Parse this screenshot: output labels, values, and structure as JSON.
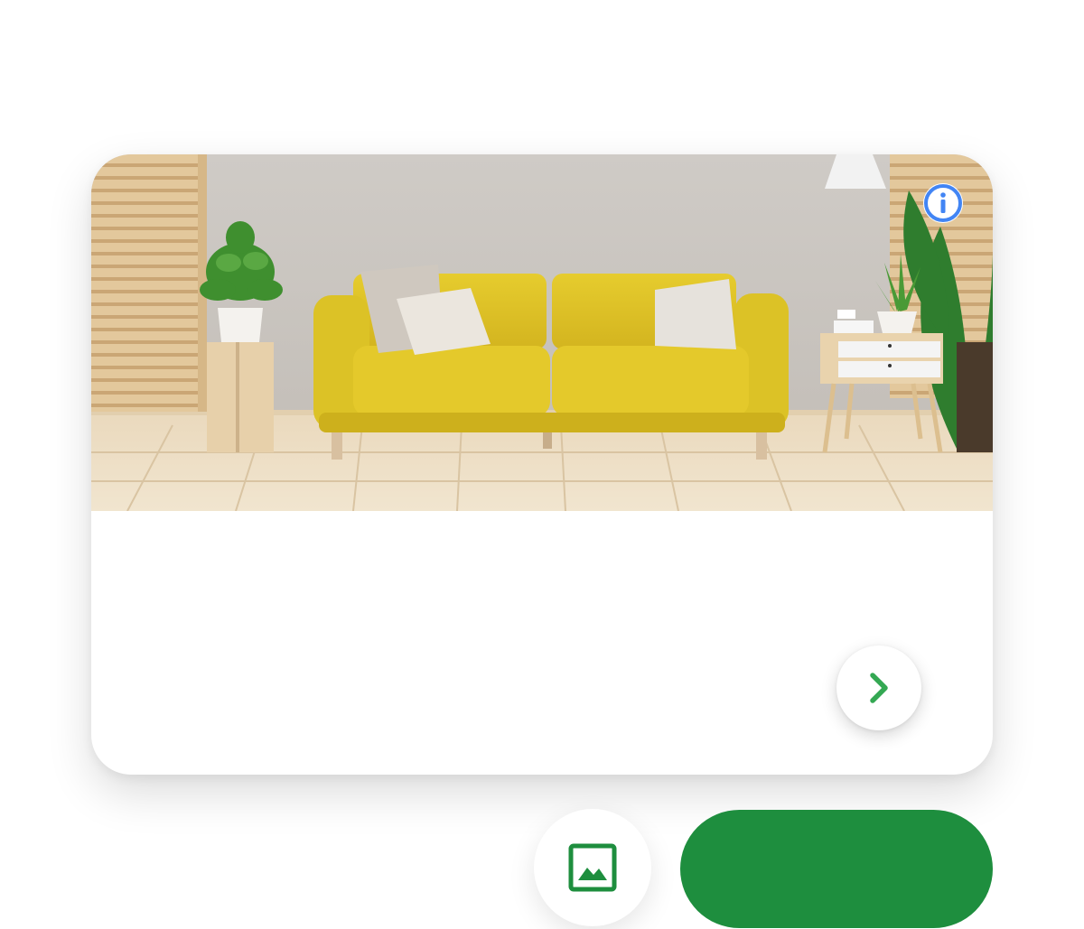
{
  "card": {
    "image": {
      "subject": "living-room-yellow-sofa",
      "icon": "info-icon",
      "info_color": "#4285f4"
    },
    "next_button": {
      "icon": "chevron-right-icon",
      "color": "#34a853"
    }
  },
  "actions": {
    "gallery_button": {
      "icon": "image-icon",
      "color": "#1e8e3e"
    },
    "primary_button": {
      "label": "",
      "color": "#1e8e3e"
    }
  }
}
